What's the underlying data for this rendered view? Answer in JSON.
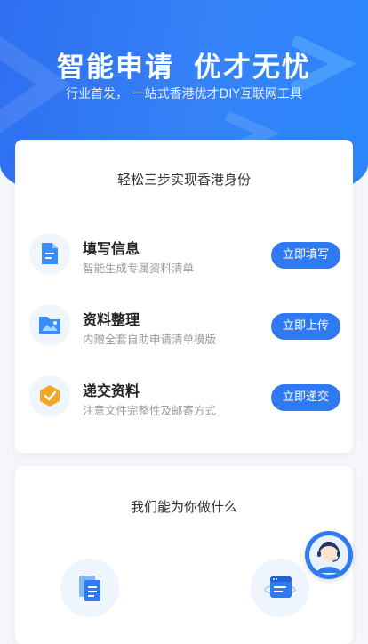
{
  "hero": {
    "title_left": "智能申请",
    "title_right": "优才无忧",
    "subtitle": "行业首发，  一站式香港优才DIY互联网工具"
  },
  "steps_card": {
    "title": "轻松三步实现香港身份",
    "steps": [
      {
        "title": "填写信息",
        "desc": "智能生成专属资料清单",
        "button": "立即填写",
        "icon": "document-icon"
      },
      {
        "title": "资料整理",
        "desc": "内赠全套自助申请清单模版",
        "button": "立即上传",
        "icon": "folder-image-icon"
      },
      {
        "title": "递交资料",
        "desc": "注意文件完整性及邮寄方式",
        "button": "立即递交",
        "icon": "check-shield-icon"
      }
    ]
  },
  "features_card": {
    "title": "我们能为你做什么",
    "features": [
      {
        "icon": "document-stack-icon"
      },
      {
        "icon": "browser-window-icon"
      }
    ]
  },
  "support": {
    "icon": "customer-service-avatar-icon"
  },
  "colors": {
    "primary": "#2f7af2",
    "hero_gradient_start": "#2e6ff0",
    "hero_gradient_end": "#2b86fb",
    "icon_bg": "#eef5fd",
    "check_orange": "#f5a623"
  }
}
